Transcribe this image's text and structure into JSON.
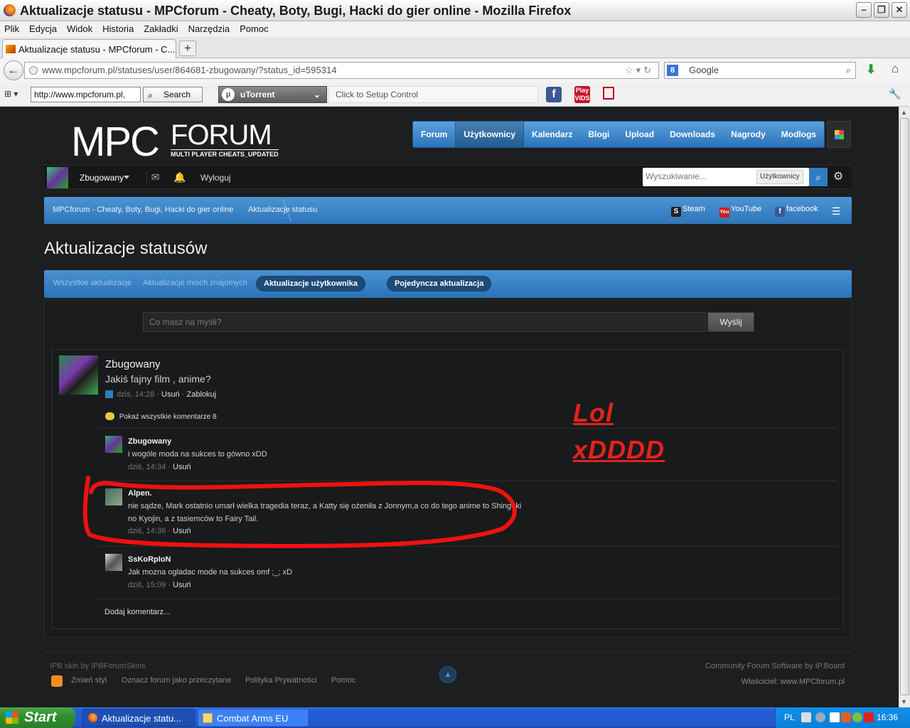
{
  "window": {
    "title": "Aktualizacje statusu - MPCforum - Cheaty, Boty, Bugi, Hacki do gier online - Mozilla Firefox"
  },
  "menubar": [
    "Plik",
    "Edycja",
    "Widok",
    "Historia",
    "Zakładki",
    "Narzędzia",
    "Pomoc"
  ],
  "tab": {
    "label": "Aktualizacje statusu - MPCforum - C..."
  },
  "navbar": {
    "url": "www.mpcforum.pl/statuses/user/864681-zbugowany/?status_id=595314",
    "search_placeholder": "Google",
    "search_engine_icon": "8"
  },
  "toolbar2": {
    "url_value": "http://www.mpcforum.pl,",
    "search_label": "Search",
    "utorrent_label": "uTorrent",
    "setup_label": "Click to Setup Control",
    "fb_badge": "f",
    "play_label": "Play",
    "play_sub": "VIDS"
  },
  "site": {
    "logo_main": "MPC",
    "logo_forum": "FORUM",
    "logo_tagline": "MULTI PLAYER CHEATS_UPDATED",
    "nav": [
      "Forum",
      "Użytkownicy",
      "Kalendarz",
      "Blogi",
      "Upload",
      "Downloads",
      "Nagrody",
      "Modlogs"
    ],
    "user": {
      "name": "Zbugowany",
      "logout": "Wyloguj"
    },
    "search": {
      "placeholder": "Wyszukiwanie...",
      "scope": "Użytkownicy"
    },
    "breadcrumb": {
      "home": "MPCforum - Cheaty, Boty, Bugi, Hacki do gier online",
      "current": "Aktualizacje statusu"
    },
    "social": {
      "steam": "Steam",
      "youtube": "YouTube",
      "facebook": "facebook"
    },
    "page_title": "Aktualizacje statusów",
    "subtabs": {
      "all": "Wszystkie aktualizacje",
      "friends": "Aktualizacje moich znajomych",
      "user": "Aktualizacje użytkownika",
      "single": "Pojedyncza aktualizacja"
    },
    "composer": {
      "placeholder": "Co masz na myśli?",
      "send": "Wyślij"
    },
    "status": {
      "author": "Zbugowany",
      "text": "Jakiś fajny film , anime?",
      "time": "dziś, 14:28",
      "delete": "Usuń",
      "block": "Zablokuj",
      "show_all": "Pokaż wszystkie komentarze 8"
    },
    "annotation": {
      "line1": "Lol",
      "line2": "xDDDD"
    },
    "comments": [
      {
        "author": "Zbugowany",
        "text": "i wogóle moda na sukces to gówno xDD",
        "time": "dziś, 14:34",
        "delete": "Usuń"
      },
      {
        "author": "Alpen.",
        "text": "nie sądze, Mark ostatnio umarł wielka tragedia teraz, a Katty się ożeniła z Jonnym,a co do tego anime to Shingeki no Kyojin, a z tasiemców to Fairy Tail.",
        "time": "dziś, 14:36",
        "delete": "Usuń"
      },
      {
        "author": "SsKoRpIoN",
        "text": "Jak mozna ogladac mode na sukces omf ;_; xD",
        "time": "dziś, 15:09",
        "delete": "Usuń"
      }
    ],
    "add_comment": "Dodaj komentarz...",
    "footer": {
      "skin": "IPB skin by IPBForumSkins",
      "links": [
        "Zmień styl",
        "Oznacz forum jako przeczytane",
        "Polityka Prywatności",
        "Pomoc"
      ],
      "software": "Community Forum Software by IP.Board",
      "owner": "Właściciel: www.MPCforum.pl"
    }
  },
  "taskbar": {
    "start": "Start",
    "tasks": [
      "Aktualizacje statu...",
      "Combat Arms EU"
    ],
    "lang": "PL",
    "clock": "16:36"
  }
}
